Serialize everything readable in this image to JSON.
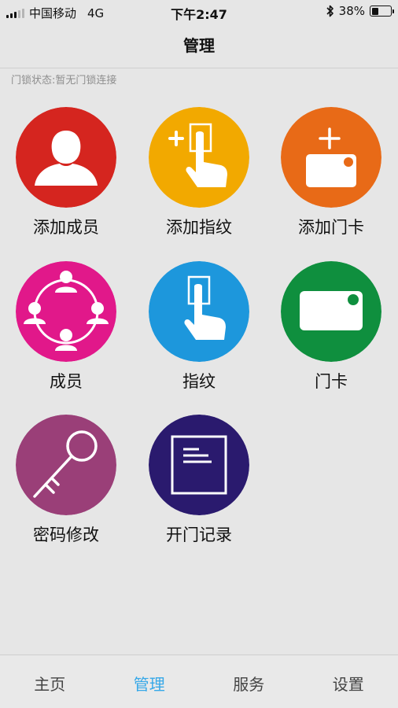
{
  "status_bar": {
    "carrier": "中国移动",
    "network": "4G",
    "time": "下午2:47",
    "battery_percent": "38%",
    "battery_level": 0.38
  },
  "nav": {
    "title": "管理"
  },
  "lock_status": "门锁状态:暂无门锁连接",
  "grid": {
    "items": [
      {
        "label": "添加成员",
        "icon": "add-member-icon",
        "color": "#d5251f"
      },
      {
        "label": "添加指纹",
        "icon": "add-fingerprint-icon",
        "color": "#f2a900"
      },
      {
        "label": "添加门卡",
        "icon": "add-card-icon",
        "color": "#e86a17"
      },
      {
        "label": "成员",
        "icon": "members-icon",
        "color": "#e1188a"
      },
      {
        "label": "指纹",
        "icon": "fingerprint-icon",
        "color": "#1d97dc"
      },
      {
        "label": "门卡",
        "icon": "card-icon",
        "color": "#0f8f3e"
      },
      {
        "label": "密码修改",
        "icon": "key-icon",
        "color": "#9a3f78"
      },
      {
        "label": "开门记录",
        "icon": "record-icon",
        "color": "#2a1a6e"
      }
    ]
  },
  "tabs": [
    {
      "label": "主页",
      "active": false
    },
    {
      "label": "管理",
      "active": true
    },
    {
      "label": "服务",
      "active": false
    },
    {
      "label": "设置",
      "active": false
    }
  ],
  "colors": {
    "active_tab": "#36a8e8",
    "background": "#e6e6e6"
  }
}
